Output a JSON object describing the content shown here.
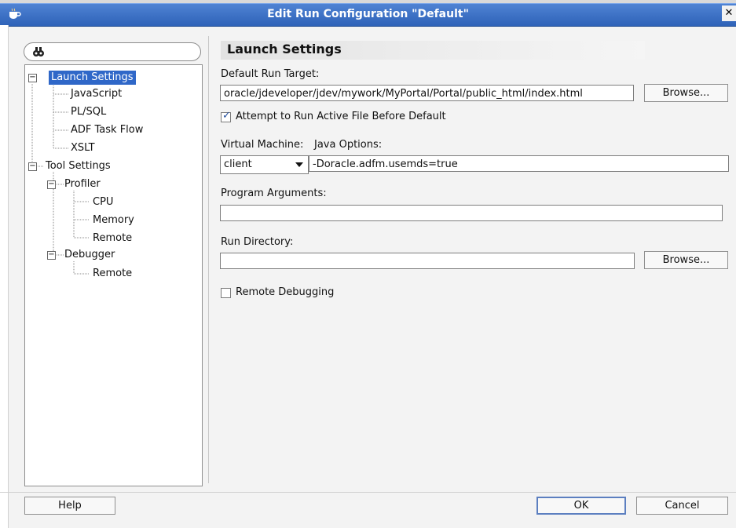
{
  "window": {
    "title": "Edit Run Configuration \"Default\""
  },
  "left_panel": {
    "search_placeholder": "",
    "tree": [
      {
        "label": "Launch Settings",
        "selected": true,
        "expanded": true
      },
      {
        "label": "JavaScript"
      },
      {
        "label": "PL/SQL"
      },
      {
        "label": "ADF Task Flow"
      },
      {
        "label": "XSLT"
      },
      {
        "label": "Tool Settings",
        "expanded": true
      },
      {
        "label": "Profiler",
        "expanded": true
      },
      {
        "label": "CPU"
      },
      {
        "label": "Memory"
      },
      {
        "label": "Remote"
      },
      {
        "label": "Debugger",
        "expanded": true
      },
      {
        "label": "Remote"
      }
    ]
  },
  "right_panel": {
    "title": "Launch Settings",
    "default_run_target_label": "Default Run Target:",
    "default_run_target_value": "oracle/jdeveloper/jdev/mywork/MyPortal/Portal/public_html/index.html",
    "browse_label": "Browse...",
    "attempt_run_label": "Attempt to Run Active File Before Default",
    "attempt_run_checked": true,
    "virtual_machine_label": "Virtual Machine:",
    "virtual_machine_value": "client",
    "java_options_label": "Java Options:",
    "java_options_value": "-Doracle.adfm.usemds=true",
    "program_arguments_label": "Program Arguments:",
    "program_arguments_value": "",
    "run_directory_label": "Run Directory:",
    "run_directory_value": "",
    "browse2_label": "Browse...",
    "remote_debugging_label": "Remote Debugging",
    "remote_debugging_checked": false
  },
  "buttons": {
    "help": "Help",
    "ok": "OK",
    "cancel": "Cancel"
  },
  "icons": {
    "app": "java-cup-icon",
    "search": "binoculars-icon",
    "close": "close-icon",
    "combo": "chevron-down-icon"
  }
}
